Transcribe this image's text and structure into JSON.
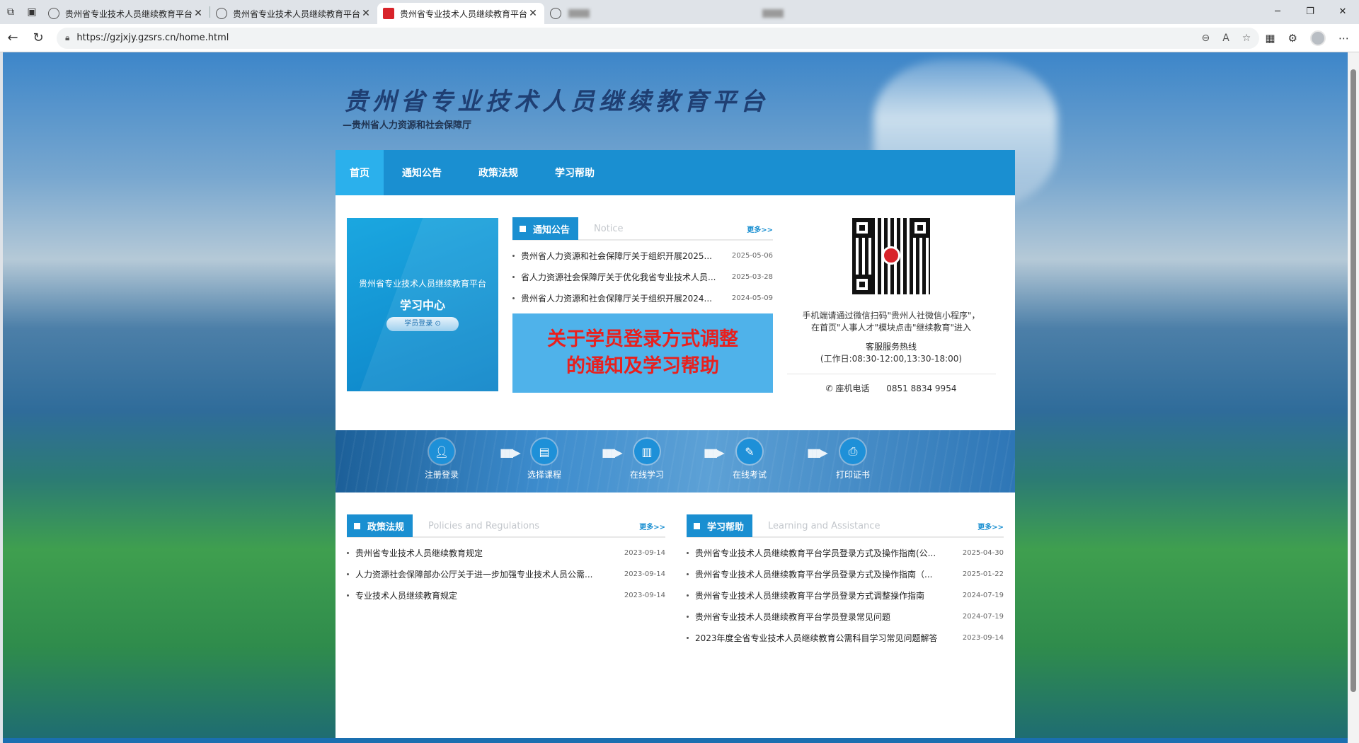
{
  "browser": {
    "tabs": [
      {
        "title": "贵州省专业技术人员继续教育平台",
        "close": "✕"
      },
      {
        "title": "贵州省专业技术人员继续教育平台",
        "close": "✕"
      },
      {
        "title": "贵州省专业技术人员继续教育平台",
        "close": "✕"
      }
    ],
    "url": "https://gzjxjy.gzsrs.cn/home.html"
  },
  "header": {
    "title": "贵州省专业技术人员继续教育平台",
    "subtitle": "—贵州省人力资源和社会保障厅"
  },
  "nav": [
    "首页",
    "通知公告",
    "政策法规",
    "学习帮助"
  ],
  "learning_card": {
    "title": "贵州省专业技术人员继续教育平台",
    "heading": "学习中心",
    "button": "学员登录 ⊙"
  },
  "notice": {
    "tag": "通知公告",
    "en": "Notice",
    "more": "更多>>",
    "items": [
      {
        "text": "贵州省人力资源和社会保障厅关于组织开展2025...",
        "date": "2025-05-06"
      },
      {
        "text": "省人力资源社会保障厅关于优化我省专业技术人员...",
        "date": "2025-03-28"
      },
      {
        "text": "贵州省人力资源和社会保障厅关于组织开展2024...",
        "date": "2024-05-09"
      }
    ]
  },
  "promo": {
    "line1": "关于学员登录方式调整",
    "line2": "的通知及学习帮助"
  },
  "contact": {
    "scan": "手机端请通过微信扫码\"贵州人社微信小程序\"，",
    "scan2": "在首页\"人事人才\"模块点击\"继续教育\"进入",
    "hotline": "客服服务热线",
    "hours": "(工作日:08:30-12:00,13:30-18:00)",
    "phone_label": "✆ 座机电话",
    "phone": "0851 8834 9954"
  },
  "process": [
    "注册登录",
    "选择课程",
    "在线学习",
    "在线考试",
    "打印证书"
  ],
  "policy": {
    "tag": "政策法规",
    "en": "Policies and Regulations",
    "more": "更多>>",
    "items": [
      {
        "text": "贵州省专业技术人员继续教育规定",
        "date": "2023-09-14"
      },
      {
        "text": "人力资源社会保障部办公厅关于进一步加强专业技术人员公需...",
        "date": "2023-09-14"
      },
      {
        "text": "专业技术人员继续教育规定",
        "date": "2023-09-14"
      }
    ]
  },
  "help": {
    "tag": "学习帮助",
    "en": "Learning and Assistance",
    "more": "更多>>",
    "items": [
      {
        "text": "贵州省专业技术人员继续教育平台学员登录方式及操作指南(公...",
        "date": "2025-04-30"
      },
      {
        "text": "贵州省专业技术人员继续教育平台学员登录方式及操作指南（...",
        "date": "2025-01-22"
      },
      {
        "text": "贵州省专业技术人员继续教育平台学员登录方式调整操作指南",
        "date": "2024-07-19"
      },
      {
        "text": "贵州省专业技术人员继续教育平台学员登录常见问题",
        "date": "2024-07-19"
      },
      {
        "text": "2023年度全省专业技术人员继续教育公需科目学习常见问题解答",
        "date": "2023-09-14"
      }
    ]
  },
  "colors": {
    "primary": "#1a8fd1",
    "active_nav": "#2bb0ec",
    "promo_bg": "#4fb2ea",
    "promo_text": "#e8201e"
  }
}
